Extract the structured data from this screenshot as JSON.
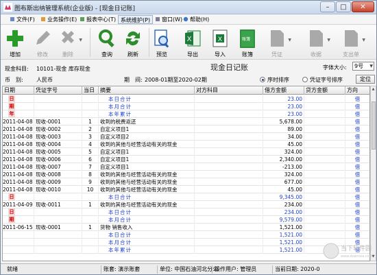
{
  "window": {
    "title": "图布斯出纳管理系统(企业版) - [现金日记账]"
  },
  "menu": [
    {
      "label": "文件(F)",
      "boxed": false
    },
    {
      "label": "业务操作(E)",
      "boxed": false
    },
    {
      "label": "报表中心(T)",
      "boxed": false
    },
    {
      "label": "系统维护(P)",
      "boxed": true
    },
    {
      "label": "窗口(W)",
      "boxed": false
    },
    {
      "label": "帮助(H)",
      "boxed": false
    }
  ],
  "toolbar": {
    "add": "增加",
    "edit": "修改",
    "delete": "删除",
    "query": "查询",
    "refresh": "刷新",
    "preview": "预览",
    "export": "导出",
    "import": "导入",
    "ledger": "账簿",
    "voucher": "凭证",
    "receipt": "收据",
    "payment": "支出单",
    "ledger_icon_text": "账簿"
  },
  "info": {
    "subject_label": "现金科目:",
    "subject_value": "10101-现金 库存现金",
    "currency_label": "币　别:",
    "currency_value": "人民币",
    "period_label": "期　间:",
    "period_value": "2008-01期至2020-02期",
    "ledger_title": "现金日记账",
    "font_size_label": "字体大小:",
    "font_size_value": "9号",
    "sort_time": "序时排序",
    "sort_voucher": "凭证字号排序",
    "sort_selected": "序时排序",
    "locate": "定位"
  },
  "table": {
    "headers": [
      "日期",
      "凭证字号",
      "当日",
      "摘要",
      "对方科目",
      "借方金额",
      "贷方金额",
      "方向"
    ],
    "rows": [
      {
        "tag": "日",
        "date": "",
        "voucher": "",
        "day": "",
        "summary": "本日合计",
        "opposite": "",
        "debit": "23.00",
        "credit": "",
        "dir": "借",
        "total": true
      },
      {
        "tag": "期",
        "date": "",
        "voucher": "",
        "day": "",
        "summary": "本月合计",
        "opposite": "",
        "debit": "23.00",
        "credit": "",
        "dir": "借",
        "total": true
      },
      {
        "tag": "年",
        "date": "",
        "voucher": "",
        "day": "",
        "summary": "本年累计",
        "opposite": "",
        "debit": "23.00",
        "credit": "",
        "dir": "借",
        "total": true
      },
      {
        "tag": "",
        "date": "2011-04-08",
        "voucher": "现收-0001",
        "day": "1",
        "summary": "收到的税费返还",
        "opposite": "",
        "debit": "5,678.00",
        "credit": "",
        "dir": "借",
        "total": false
      },
      {
        "tag": "",
        "date": "2011-04-08",
        "voucher": "现收-0002",
        "day": "2",
        "summary": "自定义项目1",
        "opposite": "",
        "debit": "89.00",
        "credit": "",
        "dir": "借",
        "total": false
      },
      {
        "tag": "",
        "date": "2011-04-08",
        "voucher": "现收-0003",
        "day": "3",
        "summary": "自定义项目2",
        "opposite": "",
        "debit": "34.00",
        "credit": "",
        "dir": "借",
        "total": false
      },
      {
        "tag": "",
        "date": "2011-04-08",
        "voucher": "现收-0004",
        "day": "4",
        "summary": "收到的其他与经营活动有关的现金",
        "opposite": "",
        "debit": "45.00",
        "credit": "",
        "dir": "借",
        "total": false
      },
      {
        "tag": "",
        "date": "2011-04-08",
        "voucher": "现收-0005",
        "day": "5",
        "summary": "自定义项目1",
        "opposite": "",
        "debit": "324.00",
        "credit": "",
        "dir": "借",
        "total": false
      },
      {
        "tag": "",
        "date": "2011-04-08",
        "voucher": "现收-0006",
        "day": "6",
        "summary": "自定义项目1",
        "opposite": "",
        "debit": "2,340.00",
        "credit": "",
        "dir": "借",
        "total": false
      },
      {
        "tag": "",
        "date": "2011-04-08",
        "voucher": "现收-0007",
        "day": "7",
        "summary": "自定义项目1",
        "opposite": "",
        "debit": "-213.00",
        "credit": "",
        "dir": "借",
        "total": false
      },
      {
        "tag": "",
        "date": "2011-04-08",
        "voucher": "现收-0008",
        "day": "8",
        "summary": "收到的其他与经营活动有关的现金",
        "opposite": "",
        "debit": "324.00",
        "credit": "",
        "dir": "借",
        "total": false
      },
      {
        "tag": "",
        "date": "2011-04-08",
        "voucher": "现收-0009",
        "day": "9",
        "summary": "收到的其他与经营活动有关的现金",
        "opposite": "",
        "debit": "677.00",
        "credit": "",
        "dir": "借",
        "total": false
      },
      {
        "tag": "",
        "date": "2011-04-08",
        "voucher": "现收-0010",
        "day": "10",
        "summary": "收到的其他与经营活动有关的现金",
        "opposite": "",
        "debit": "45.00",
        "credit": "",
        "dir": "借",
        "total": false
      },
      {
        "tag": "日",
        "date": "",
        "voucher": "",
        "day": "",
        "summary": "本日合计",
        "opposite": "",
        "debit": "9,345.00",
        "credit": "",
        "dir": "借",
        "total": true
      },
      {
        "tag": "",
        "date": "2011-04-09",
        "voucher": "现收-0011",
        "day": "1",
        "summary": "收到的其他与经营活动有关的现金",
        "opposite": "",
        "debit": "234.00",
        "credit": "",
        "dir": "借",
        "total": false
      },
      {
        "tag": "日",
        "date": "",
        "voucher": "",
        "day": "",
        "summary": "本日合计",
        "opposite": "",
        "debit": "234.00",
        "credit": "",
        "dir": "借",
        "total": true
      },
      {
        "tag": "期",
        "date": "",
        "voucher": "",
        "day": "",
        "summary": "本月合计",
        "opposite": "",
        "debit": "9,579.00",
        "credit": "",
        "dir": "借",
        "total": true
      },
      {
        "tag": "",
        "date": "2011-06-15",
        "voucher": "现收-0001",
        "day": "1",
        "summary": "货物 销售收入",
        "opposite": "",
        "debit": "1,521.00",
        "credit": "",
        "dir": "借",
        "total": false
      },
      {
        "tag": "",
        "date": "",
        "voucher": "",
        "day": "",
        "summary": "本日合计",
        "opposite": "",
        "debit": "1,521.00",
        "credit": "",
        "dir": "借",
        "total": true
      },
      {
        "tag": "",
        "date": "",
        "voucher": "",
        "day": "",
        "summary": "本月合计",
        "opposite": "",
        "debit": "1,521.00",
        "credit": "",
        "dir": "借",
        "total": true
      },
      {
        "tag": "",
        "date": "",
        "voucher": "",
        "day": "",
        "summary": "本年累计",
        "opposite": "",
        "debit": "1,521.00",
        "credit": "",
        "dir": "借",
        "total": true
      }
    ]
  },
  "status": {
    "ready": "就绪",
    "account": "账套: 演示账套",
    "unit": "单位: 中国石油河北分公",
    "user": "操作用户: 管理员",
    "date": "当前日期: 2020-0"
  },
  "watermark": {
    "text": "当下软件园",
    "sub": "www.downxia.com"
  },
  "colors": {
    "accent": "#1f3fcf",
    "tag_red": "#c00000"
  }
}
